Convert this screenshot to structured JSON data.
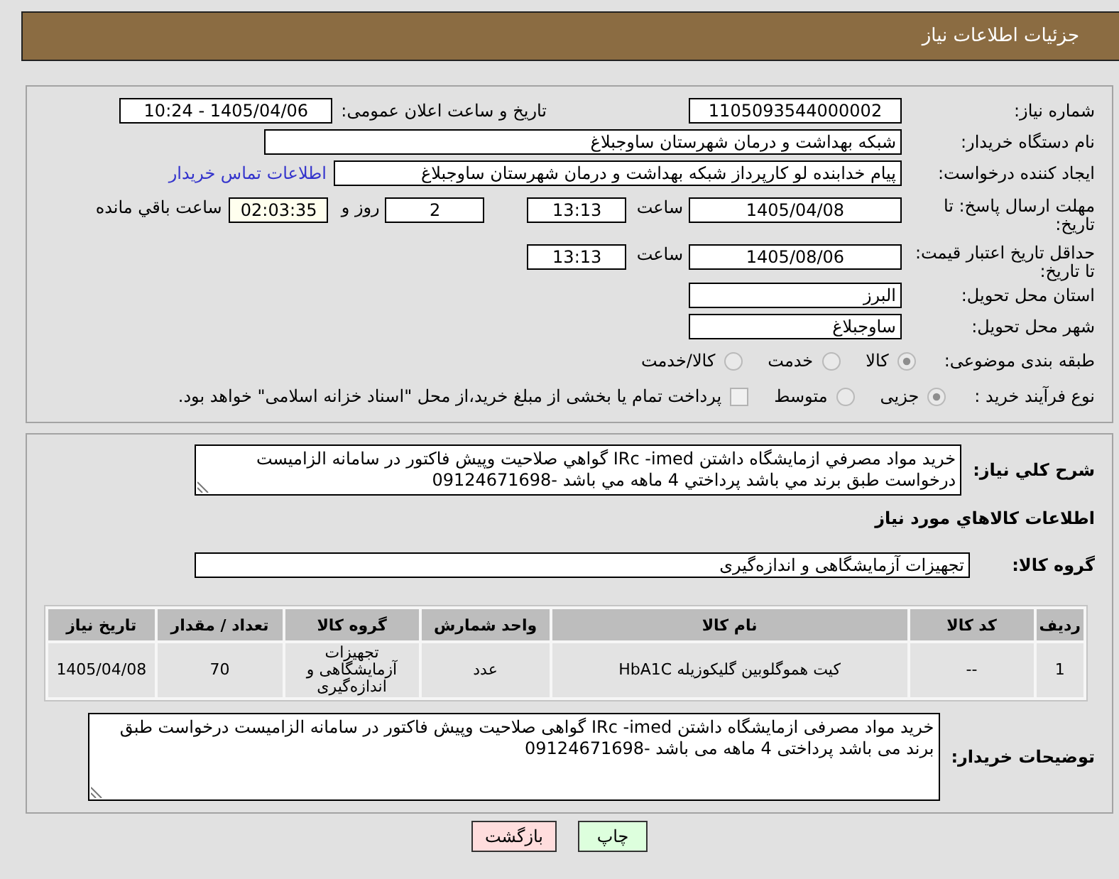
{
  "header": {
    "title": "جزئیات اطلاعات نیاز"
  },
  "need_number": {
    "label": "شماره نیاز:",
    "value": "1105093544000002"
  },
  "announcement": {
    "label": "تاریخ و ساعت اعلان عمومی:",
    "value": "1405/04/06 - 10:24"
  },
  "buyer_organization": {
    "label": "نام دستگاه خریدار:",
    "value": "شبکه بهداشت و درمان شهرستان ساوجبلاغ"
  },
  "requester": {
    "label": "ایجاد کننده درخواست:",
    "value": "پیام خدابنده لو کارپرداز شبکه بهداشت و درمان شهرستان ساوجبلاغ",
    "contact_link": "اطلاعات تماس خریدار"
  },
  "response_deadline": {
    "label": "مهلت ارسال پاسخ: تا تاریخ:",
    "date": "1405/04/08",
    "time_label": "ساعت",
    "time": "13:13",
    "days": "2",
    "days_label": "روز و",
    "remaining": "02:03:35",
    "remaining_label": "ساعت باقي مانده"
  },
  "price_validity": {
    "label": "حداقل تاریخ اعتبار قیمت: تا تاریخ:",
    "date": "1405/08/06",
    "time_label": "ساعت",
    "time": "13:13"
  },
  "delivery_province": {
    "label": "استان محل تحویل:",
    "value": "البرز"
  },
  "delivery_city": {
    "label": "شهر محل تحویل:",
    "value": "ساوجبلاغ"
  },
  "subject_category": {
    "label": "طبقه بندی موضوعی:",
    "options": [
      {
        "label": "کالا",
        "selected": true
      },
      {
        "label": "خدمت",
        "selected": false
      },
      {
        "label": "کالا/خدمت",
        "selected": false
      }
    ]
  },
  "purchase_process": {
    "label": "نوع فرآیند خرید :",
    "options": [
      {
        "label": "جزیی",
        "selected": true
      },
      {
        "label": "متوسط",
        "selected": false
      }
    ],
    "treasury_payment": {
      "label": "پرداخت تمام یا بخشی از مبلغ خرید،از محل \"اسناد خزانه اسلامی\" خواهد بود.",
      "checked": false
    }
  },
  "general_description": {
    "label": "شرح کلي نیاز:",
    "value": "خريد مواد مصرفي ازمايشگاه داشتن IRc -imed گواهي صلاحيت وپيش فاکتور در سامانه الزاميست درخواست طبق برند مي باشد پرداختي 4 ماهه مي باشد -09124671698"
  },
  "goods": {
    "title": "اطلاعات کالاهاي مورد نیاز",
    "group_label": "گروه کالا:",
    "group_value": "تجهیزات آزمایشگاهی و اندازه‌گیری",
    "table": {
      "columns": [
        "ردیف",
        "کد کالا",
        "نام کالا",
        "واحد شمارش",
        "گروه کالا",
        "تعداد / مقدار",
        "تاریخ نیاز"
      ],
      "rows": [
        [
          "1",
          "--",
          "کیت هموگلوبین گلیکوزیله HbA1C",
          "عدد",
          "تجهیزات آزمایشگاهی و اندازه‌گیری",
          "70",
          "1405/04/08"
        ]
      ]
    }
  },
  "buyer_notes": {
    "label": "توضیحات خریدار:",
    "value": "خرید مواد مصرفی ازمایشگاه داشتن IRc -imed گواهی صلاحیت وپیش فاکتور در سامانه الزامیست درخواست طبق برند می باشد پرداختی 4 ماهه می باشد -09124671698"
  },
  "buttons": [
    {
      "kind": "print",
      "label": "چاپ"
    },
    {
      "kind": "back",
      "label": "بازگشت"
    }
  ]
}
